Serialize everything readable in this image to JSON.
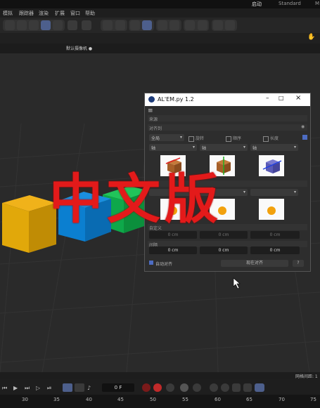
{
  "workspace_tabs": {
    "active": "启动",
    "standard": "Standard",
    "more": "M"
  },
  "menu": [
    "模拟",
    "跟踪器",
    "渲染",
    "扩展",
    "窗口",
    "帮助"
  ],
  "viewport": {
    "camera_label": "默认摄像机 ●"
  },
  "status": {
    "grid_spacing": "网格间距: 1"
  },
  "dialog": {
    "title": "AL'EM.py 1.2",
    "section_source": "来源",
    "section_align": "对齐到",
    "align_mode": "全局",
    "opt_randomize": "旋转",
    "opt_order": "顺序",
    "opt_lengthwise": "长度",
    "axis_labels": [
      "轴",
      "轴",
      "轴"
    ],
    "section_target": "目标",
    "section_custom": "自定义",
    "custom_values": [
      "0 cm",
      "0 cm",
      "0 cm"
    ],
    "section_spacing": "间隔",
    "spacing_values": [
      "0 cm",
      "0 cm",
      "0 cm"
    ],
    "auto_align": "自动对齐",
    "align_now": "现在对齐",
    "help": "?"
  },
  "timeline": {
    "frame": "0 F",
    "ruler": [
      "30",
      "35",
      "40",
      "45",
      "50",
      "55",
      "60",
      "65",
      "70",
      "75"
    ]
  },
  "watermark": "中文版",
  "colors": {
    "accent": "#4d5f8c",
    "watermark": "#e31a1a",
    "cube_yellow": "#e1a80a",
    "cube_blue": "#0b7fd0",
    "cube_green": "#12b24a"
  }
}
